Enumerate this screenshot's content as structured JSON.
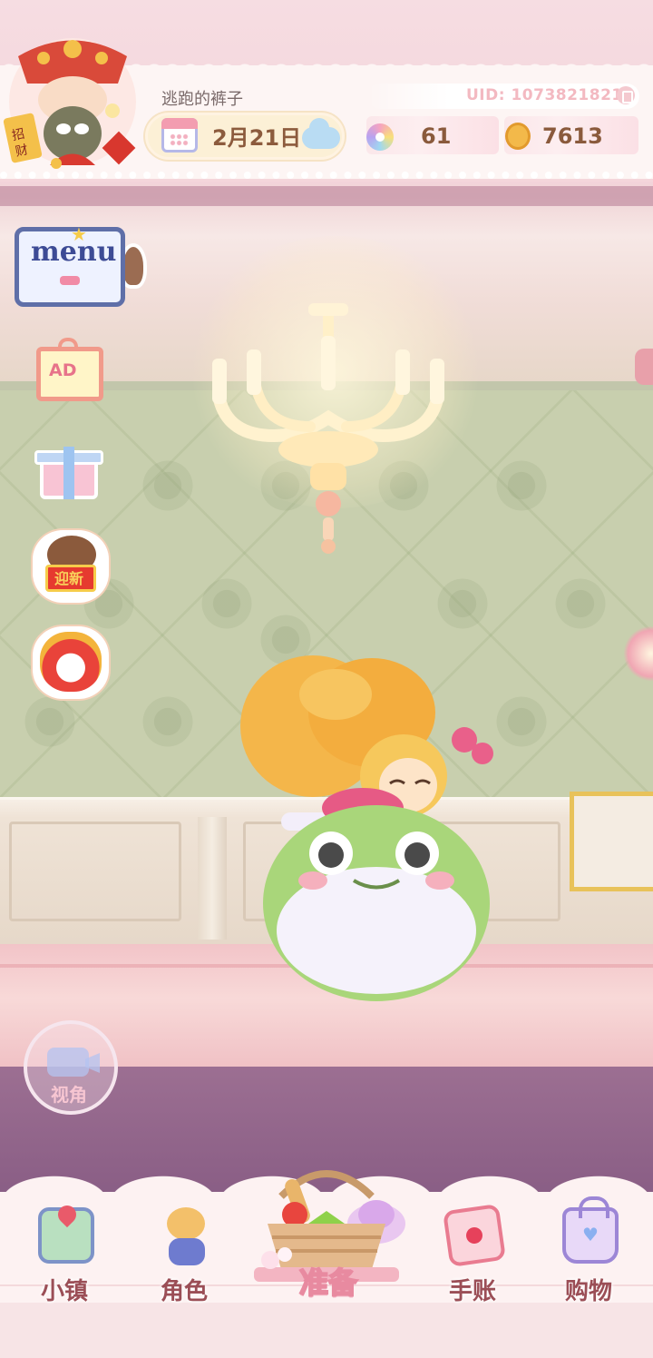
{
  "header": {
    "username": "逃跑的裤子",
    "uid": "UID: 1073821821",
    "date": "2月21日",
    "gems": "61",
    "coins": "7613"
  },
  "sidebar": {
    "menu_label": "menu",
    "ad_label": "AD",
    "newyear_label": "迎新",
    "camera_label": "视角"
  },
  "nav": {
    "items": [
      {
        "label": "小镇",
        "icon": "map-icon"
      },
      {
        "label": "角色",
        "icon": "character-icon"
      },
      {
        "label": "准备",
        "icon": "basket-icon"
      },
      {
        "label": "手账",
        "icon": "journal-icon"
      },
      {
        "label": "购物",
        "icon": "shopping-bag-icon"
      }
    ]
  },
  "colors": {
    "accent_pink": "#f3b9c1",
    "nav_label": "#9b4e56",
    "stat_text": "#8a5a3c"
  }
}
